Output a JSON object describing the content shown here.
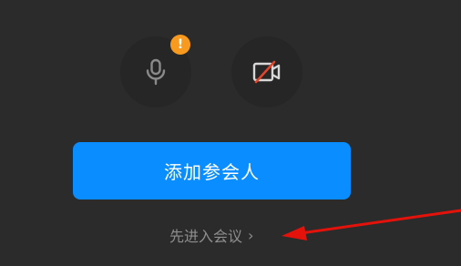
{
  "controls": {
    "mic_icon": "microphone-icon",
    "mic_warning_badge": "!",
    "camera_icon": "camera-off-icon"
  },
  "actions": {
    "add_participants_label": "添加参会人",
    "enter_meeting_label": "先进入会议",
    "enter_meeting_chevron": "›"
  },
  "colors": {
    "background": "#2b2b2b",
    "icon_button_bg": "#262626",
    "primary": "#0a8dff",
    "warning": "#f79a1d",
    "annotation_arrow": "#e3120b",
    "muted_text": "#8e8e8e"
  }
}
